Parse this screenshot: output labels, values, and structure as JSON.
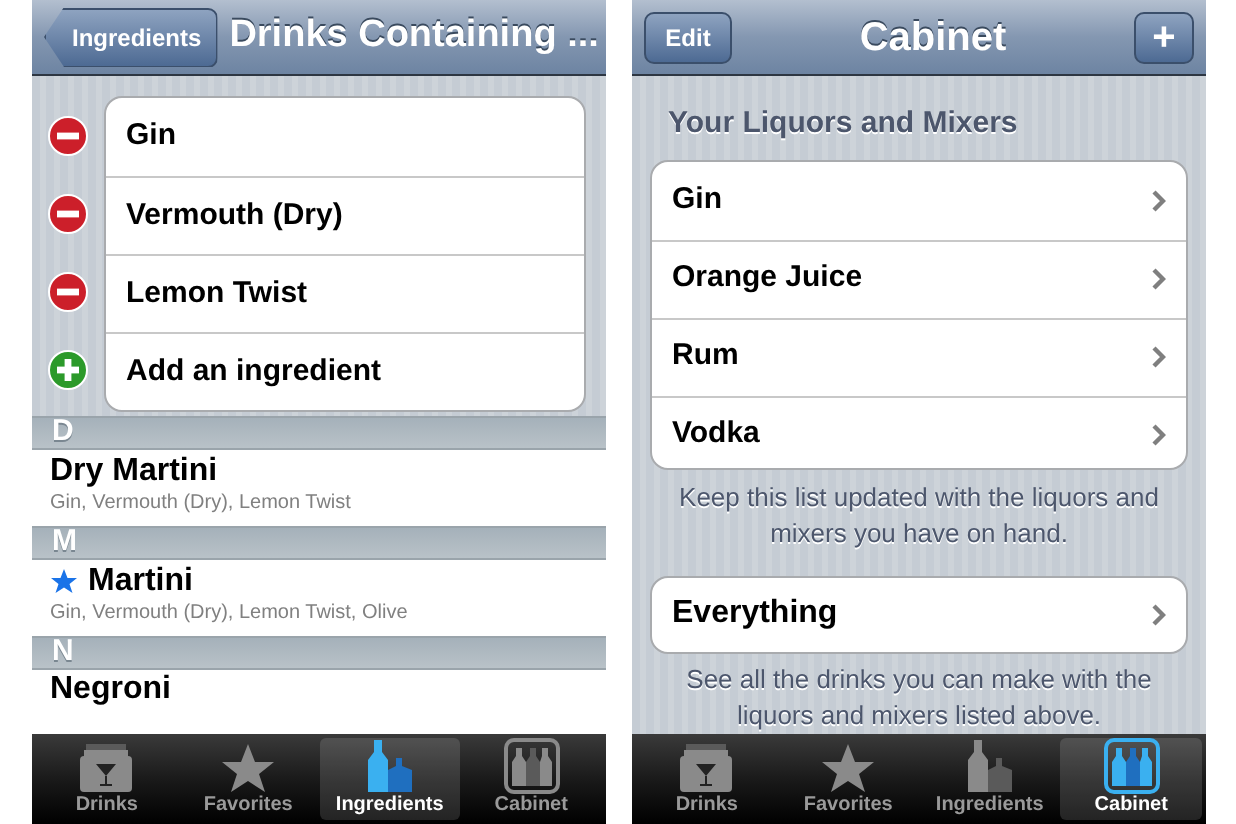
{
  "left_screen": {
    "back_button": "Ingredients",
    "title": "Drinks Containing ...",
    "ingredients": [
      {
        "kind": "remove",
        "label": "Gin"
      },
      {
        "kind": "remove",
        "label": "Vermouth (Dry)"
      },
      {
        "kind": "remove",
        "label": "Lemon Twist"
      },
      {
        "kind": "add",
        "label": "Add an ingredient"
      }
    ],
    "sections": [
      {
        "letter": "D",
        "drinks": [
          {
            "name": "Dry Martini",
            "favorite": false,
            "ingredients": "Gin, Vermouth (Dry), Lemon Twist"
          }
        ]
      },
      {
        "letter": "M",
        "drinks": [
          {
            "name": "Martini",
            "favorite": true,
            "ingredients": "Gin, Vermouth (Dry), Lemon Twist, Olive"
          }
        ]
      },
      {
        "letter": "N",
        "drinks": [
          {
            "name": "Negroni",
            "favorite": false
          }
        ]
      }
    ],
    "tabs": [
      {
        "label": "Drinks",
        "selected": false
      },
      {
        "label": "Favorites",
        "selected": false
      },
      {
        "label": "Ingredients",
        "selected": true
      },
      {
        "label": "Cabinet",
        "selected": false
      }
    ]
  },
  "right_screen": {
    "edit_button": "Edit",
    "title": "Cabinet",
    "add_button": "+",
    "group_header": "Your Liquors and Mixers",
    "items": [
      "Gin",
      "Orange Juice",
      "Rum",
      "Vodka"
    ],
    "items_footer": "Keep this list updated with the liquors and mixers you have on hand.",
    "everything_item": "Everything",
    "everything_footer": "See all the drinks you can make with the liquors and mixers listed above.",
    "tabs": [
      {
        "label": "Drinks",
        "selected": false
      },
      {
        "label": "Favorites",
        "selected": false
      },
      {
        "label": "Ingredients",
        "selected": false
      },
      {
        "label": "Cabinet",
        "selected": true
      }
    ]
  }
}
